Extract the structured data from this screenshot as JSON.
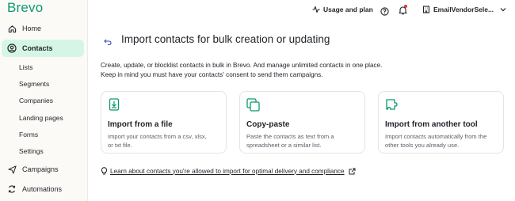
{
  "brand": {
    "logo_text": "Brevo",
    "accent_color": "#0b996e",
    "active_bg": "#d5f6e6"
  },
  "sidebar": {
    "home_label": "Home",
    "contacts_label": "Contacts",
    "sub_items": [
      "Lists",
      "Segments",
      "Companies",
      "Landing pages",
      "Forms",
      "Settings"
    ],
    "campaigns_label": "Campaigns",
    "automations_label": "Automations"
  },
  "header": {
    "usage_label": "Usage and plan",
    "account_label": "EmailVendorSele..."
  },
  "main": {
    "title": "Import contacts for bulk creation or updating",
    "description_line1": "Create, update, or blocklist contacts in bulk in Brevo. And manage unlimited contacts in one place.",
    "description_line2": "Keep in mind you must have your contacts' consent to send them campaigns.",
    "cards": [
      {
        "title": "Import from a file",
        "desc_line1": "Import your contacts from a csv, xlsx,",
        "desc_line2": "or txt file.",
        "icon": "file-import-icon"
      },
      {
        "title": "Copy-paste",
        "desc_line1": "Paste the contacts as text from a",
        "desc_line2": "spreadsheet or a similar list.",
        "icon": "copy-paste-icon"
      },
      {
        "title": "Import from another tool",
        "desc_line1": "Import contacts automatically from the",
        "desc_line2": "other tools you already use.",
        "icon": "puzzle-icon"
      }
    ],
    "learn_link": "Learn about contacts you're allowed to import for optimal delivery and compliance"
  }
}
